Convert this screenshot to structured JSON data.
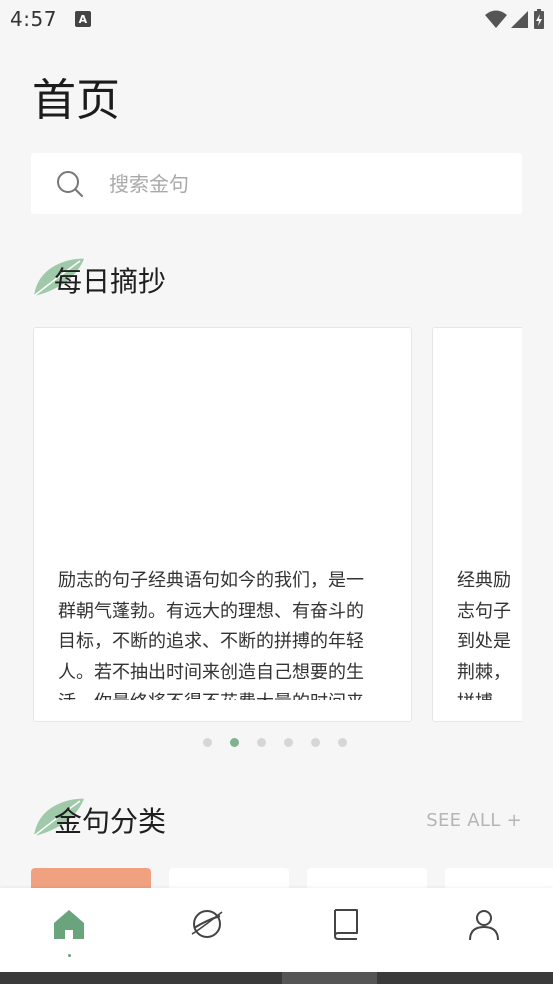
{
  "status_bar": {
    "time": "4:57",
    "badge": "A"
  },
  "page": {
    "title": "首页"
  },
  "search": {
    "placeholder": "搜索金句",
    "value": ""
  },
  "daily": {
    "title": "每日摘抄"
  },
  "cards": [
    {
      "text": "励志的句子经典语句如今的我们，是一群朝气蓬勃。有远大的理想、有奋斗的目标，不断的追求、不断的拼搏的年轻人。若不抽出时间来创造自己想要的生活，你最终将不得不花费大量的时间来"
    },
    {
      "text": "经典励志句子到处是荆棘，拼搏，就会我们。各"
    }
  ],
  "carousel": {
    "dot_count": 6,
    "active_index": 1
  },
  "categories": {
    "title": "金句分类",
    "see_all": "SEE ALL +"
  },
  "tabs": [
    {
      "name": "home",
      "icon": "home-icon",
      "active": true
    },
    {
      "name": "explore",
      "icon": "planet-icon",
      "active": false
    },
    {
      "name": "books",
      "icon": "book-icon",
      "active": false
    },
    {
      "name": "profile",
      "icon": "user-icon",
      "active": false
    }
  ],
  "colors": {
    "accent": "#6aa47c",
    "leaf": "#8fc19b",
    "category_primary": "#f0a17f"
  }
}
